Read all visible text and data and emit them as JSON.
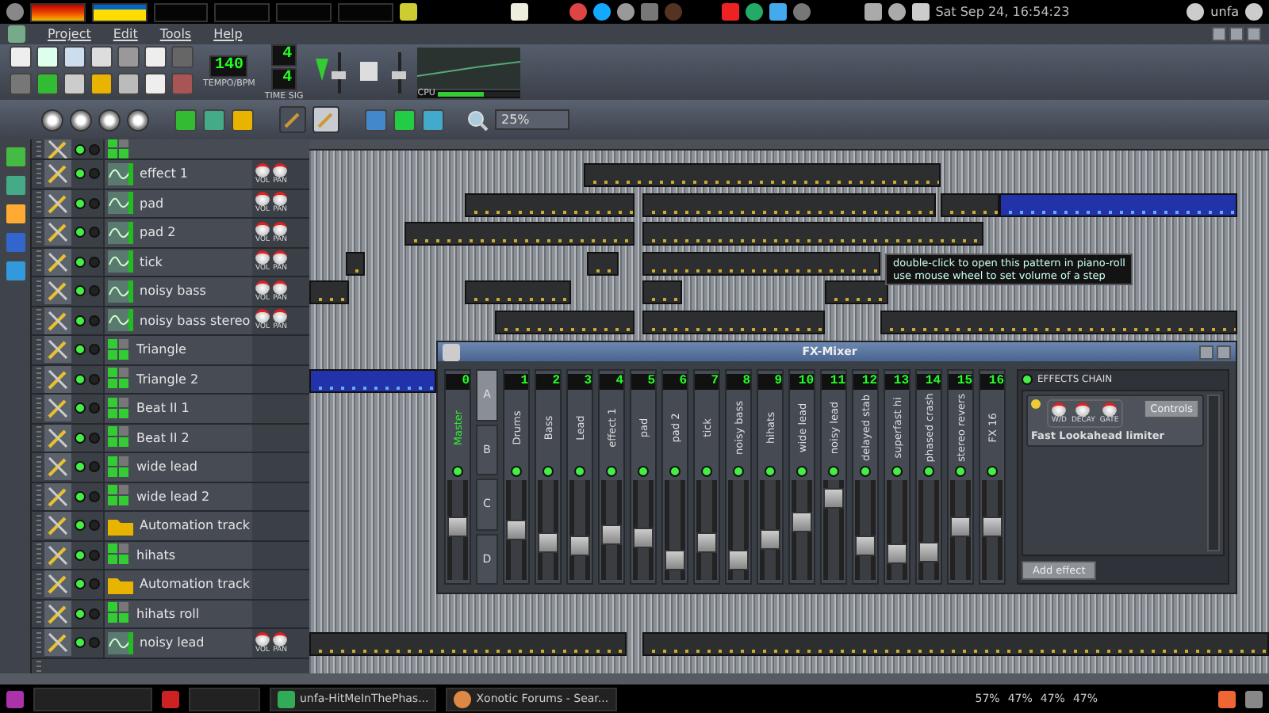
{
  "top_panel": {
    "clock": "Sat Sep 24, 16:54:23",
    "user": "unfa"
  },
  "menu": [
    "Project",
    "Edit",
    "Tools",
    "Help"
  ],
  "tempo": {
    "value": "140",
    "label": "TEMPO/BPM"
  },
  "time_sig": {
    "numerator": "4",
    "denominator": "4",
    "label": "TIME SIG"
  },
  "cpu": {
    "label": "CPU",
    "level": 0.55
  },
  "edit_tools": [
    {
      "selected": false
    },
    {
      "selected": true
    }
  ],
  "zoom": {
    "value": "25%"
  },
  "tracks": [
    {
      "name": "effect 1",
      "kind": "instrument",
      "knobs": [
        "VOL",
        "PAN"
      ]
    },
    {
      "name": "pad",
      "kind": "instrument",
      "knobs": [
        "VOL",
        "PAN"
      ]
    },
    {
      "name": "pad 2",
      "kind": "instrument",
      "knobs": [
        "VOL",
        "PAN"
      ]
    },
    {
      "name": "tick",
      "kind": "instrument",
      "knobs": [
        "VOL",
        "PAN"
      ]
    },
    {
      "name": "noisy bass",
      "kind": "instrument",
      "knobs": [
        "VOL",
        "PAN"
      ]
    },
    {
      "name": "noisy bass stereo",
      "kind": "instrument",
      "knobs": [
        "VOL",
        "PAN"
      ]
    },
    {
      "name": "Triangle",
      "kind": "beat"
    },
    {
      "name": "Triangle 2",
      "kind": "beat"
    },
    {
      "name": "Beat II 1",
      "kind": "beat"
    },
    {
      "name": "Beat II 2",
      "kind": "beat"
    },
    {
      "name": "wide lead",
      "kind": "beat"
    },
    {
      "name": "wide lead 2",
      "kind": "beat"
    },
    {
      "name": "Automation track",
      "kind": "automation"
    },
    {
      "name": "hihats",
      "kind": "beat"
    },
    {
      "name": "Automation track",
      "kind": "automation"
    },
    {
      "name": "hihats roll",
      "kind": "beat"
    },
    {
      "name": "noisy lead",
      "kind": "instrument",
      "knobs": [
        "VOL",
        "PAN"
      ]
    }
  ],
  "tooltip": {
    "lines": [
      "double-click to open this pattern in piano-roll",
      "use mouse wheel to set volume of a step"
    ]
  },
  "mixer": {
    "title": "FX-Mixer",
    "master": {
      "number": "0",
      "name": "Master",
      "level": 0.55
    },
    "banks": [
      {
        "label": "A",
        "selected": true
      },
      {
        "label": "B",
        "selected": false
      },
      {
        "label": "C",
        "selected": false
      },
      {
        "label": "D",
        "selected": false
      }
    ],
    "channels": [
      {
        "number": "1",
        "name": "Drums",
        "level": 0.5
      },
      {
        "number": "2",
        "name": "Bass",
        "level": 0.35
      },
      {
        "number": "3",
        "name": "Lead",
        "level": 0.3
      },
      {
        "number": "4",
        "name": "effect 1",
        "level": 0.45
      },
      {
        "number": "5",
        "name": "pad",
        "level": 0.4
      },
      {
        "number": "6",
        "name": "pad 2",
        "level": 0.12
      },
      {
        "number": "7",
        "name": "tick",
        "level": 0.35
      },
      {
        "number": "8",
        "name": "noisy bass",
        "level": 0.12
      },
      {
        "number": "9",
        "name": "hihats",
        "level": 0.38
      },
      {
        "number": "10",
        "name": "wide lead",
        "level": 0.6
      },
      {
        "number": "11",
        "name": "noisy lead",
        "level": 0.9
      },
      {
        "number": "12",
        "name": "delayed stab",
        "level": 0.3
      },
      {
        "number": "13",
        "name": "superfast hi",
        "level": 0.2
      },
      {
        "number": "14",
        "name": "phased crash",
        "level": 0.22
      },
      {
        "number": "15",
        "name": "stereo revers",
        "level": 0.55
      },
      {
        "number": "16",
        "name": "FX 16",
        "level": 0.55
      }
    ],
    "effects_chain": {
      "title": "EFFECTS CHAIN",
      "effects": [
        {
          "name": "Fast Lookahead limiter",
          "knobs": [
            "W/D",
            "DECAY",
            "GATE"
          ],
          "button": "Controls"
        }
      ],
      "add_button": "Add effect"
    }
  },
  "taskbar": {
    "tasks": [
      {
        "label": "unfa-HitMeInThePhas..."
      },
      {
        "label": "Xonotic Forums - Sear..."
      }
    ],
    "stats": [
      "57%",
      "47%",
      "47%",
      "47%"
    ]
  }
}
